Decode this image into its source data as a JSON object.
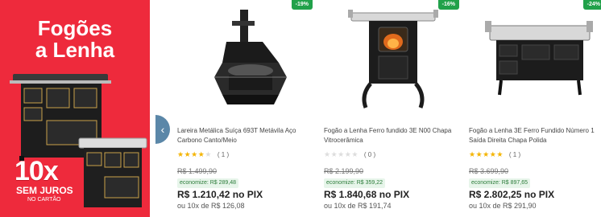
{
  "promo": {
    "title_line1": "Fogões",
    "title_line2": "a Lenha",
    "installments_big": "10x",
    "no_interest": "SEM JUROS",
    "on_card": "NO CARTÃO"
  },
  "colors": {
    "promo_bg": "#ee2a3c",
    "badge": "#21a14a",
    "star": "#f4b400",
    "arrow": "#5b87a8"
  },
  "products": [
    {
      "badge": "-19%",
      "name": "Lareira Metálica Suíça 693T Metávila Aço Carbono Canto/Meio",
      "rating_stars": 4,
      "rating_count": "( 1 )",
      "old_price": "R$ 1.499,90",
      "savings": "economize: R$ 289,48",
      "price": "R$ 1.210,42",
      "price_suffix": "no PIX",
      "installments": "ou 10x de R$ 126,08"
    },
    {
      "badge": "-16%",
      "name": "Fogão a Lenha Ferro fundido 3E N00 Chapa Vitrocerâmica",
      "rating_stars": 0,
      "rating_count": "( 0 )",
      "old_price": "R$ 2.199,90",
      "savings": "economize: R$ 359,22",
      "price": "R$ 1.840,68",
      "price_suffix": "no PIX",
      "installments": "ou 10x de R$ 191,74"
    },
    {
      "badge": "-24%",
      "name": "Fogão a Lenha 3E Ferro Fundido Número 1 Saída Direita Chapa Polida",
      "rating_stars": 5,
      "rating_count": "( 1 )",
      "old_price": "R$ 3.699,90",
      "savings": "economize: R$ 897,65",
      "price": "R$ 2.802,25",
      "price_suffix": "no PIX",
      "installments": "ou 10x de R$ 291,90"
    }
  ],
  "icons": {
    "carousel_prev": "chevron-left-icon"
  }
}
